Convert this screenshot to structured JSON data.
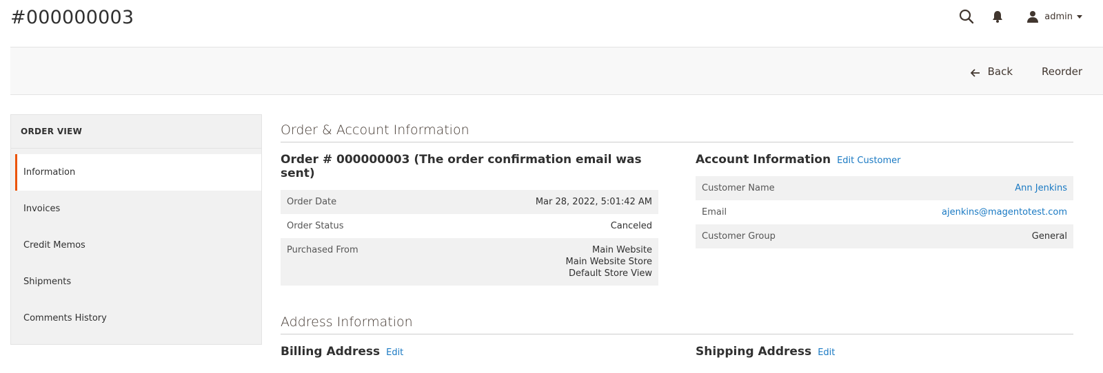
{
  "page": {
    "title": "#000000003"
  },
  "header": {
    "search_icon": "search-icon",
    "bell_icon": "bell-icon",
    "user_icon": "user-icon",
    "user_name": "admin"
  },
  "actions": {
    "back_label": "Back",
    "reorder_label": "Reorder"
  },
  "sidebar": {
    "title": "ORDER VIEW",
    "items": [
      {
        "label": "Information",
        "active": true
      },
      {
        "label": "Invoices",
        "active": false
      },
      {
        "label": "Credit Memos",
        "active": false
      },
      {
        "label": "Shipments",
        "active": false
      },
      {
        "label": "Comments History",
        "active": false
      }
    ]
  },
  "order_account": {
    "section_title": "Order & Account Information",
    "order": {
      "title": "Order # 000000003 (The order confirmation email was sent)",
      "rows": [
        {
          "label": "Order Date",
          "value": "Mar 28, 2022, 5:01:42 AM"
        },
        {
          "label": "Order Status",
          "value": "Canceled"
        },
        {
          "label": "Purchased From",
          "value_lines": [
            "Main Website",
            "Main Website Store",
            "Default Store View"
          ]
        }
      ]
    },
    "account": {
      "title": "Account Information",
      "edit_label": "Edit Customer",
      "rows": [
        {
          "label": "Customer Name",
          "value": "Ann Jenkins"
        },
        {
          "label": "Email",
          "value": "ajenkins@magentotest.com"
        },
        {
          "label": "Customer Group",
          "value": "General"
        }
      ]
    }
  },
  "address": {
    "section_title": "Address Information",
    "billing_title": "Billing Address",
    "billing_edit": "Edit",
    "shipping_title": "Shipping Address",
    "shipping_edit": "Edit"
  },
  "colors": {
    "accent": "#eb5202",
    "link": "#1979c3"
  }
}
